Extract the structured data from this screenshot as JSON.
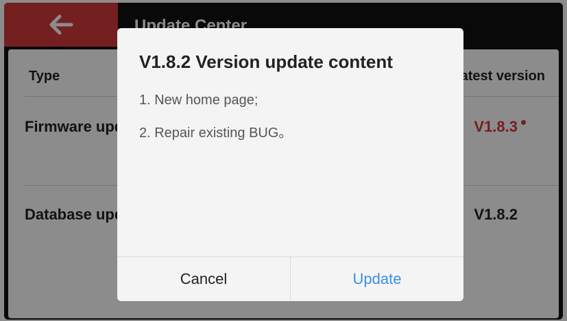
{
  "header": {
    "title": "Update Center",
    "back_icon": "arrow-left-icon"
  },
  "table": {
    "col_type": "Type",
    "col_latest": "Latest version",
    "rows": [
      {
        "label": "Firmware update",
        "latest": "V1.8.3",
        "has_update": true
      },
      {
        "label": "Database update",
        "latest": "V1.8.2",
        "has_update": false
      }
    ]
  },
  "dialog": {
    "title": "V1.8.2 Version update content",
    "lines": [
      "1. New home page;",
      "2. Repair existing BUG。"
    ],
    "cancel_label": "Cancel",
    "update_label": "Update"
  },
  "colors": {
    "accent_red": "#d3393b",
    "link_blue": "#3a8ee6",
    "topbar": "#111111"
  }
}
